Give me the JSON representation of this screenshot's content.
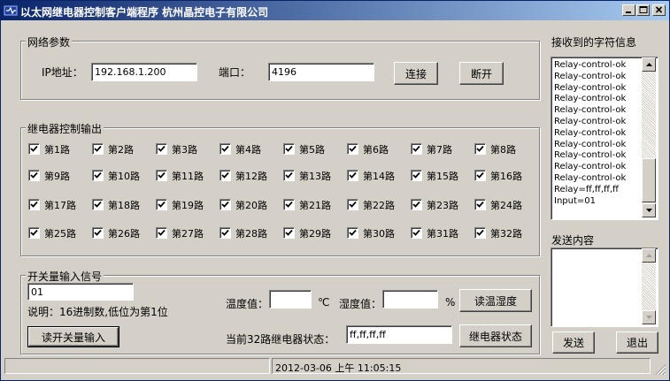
{
  "window": {
    "title": "以太网继电器控制客户端程序  杭州晶控电子有限公司"
  },
  "network": {
    "legend": "网络参数",
    "ip_label": "IP地址：",
    "ip_value": "192.168.1.200",
    "port_label": "端口：",
    "port_value": "4196",
    "connect_label": "连接",
    "disconnect_label": "断开"
  },
  "relay": {
    "legend": "继电器控制输出",
    "channels": [
      "第1路",
      "第2路",
      "第3路",
      "第4路",
      "第5路",
      "第6路",
      "第7路",
      "第8路",
      "第9路",
      "第10路",
      "第11路",
      "第12路",
      "第13路",
      "第14路",
      "第15路",
      "第16路",
      "第17路",
      "第18路",
      "第19路",
      "第20路",
      "第21路",
      "第22路",
      "第23路",
      "第24路",
      "第25路",
      "第26路",
      "第27路",
      "第28路",
      "第29路",
      "第30路",
      "第31路",
      "第32路"
    ]
  },
  "switch_input": {
    "legend": "开关量输入信号",
    "value": "01",
    "note": "说明：16进制数,低位为第1位",
    "read_label": "读开关量输入"
  },
  "sensor": {
    "temp_label": "温度值：",
    "temp_value": "",
    "temp_unit": "℃",
    "humidity_label": "湿度值：",
    "humidity_value": "",
    "humidity_unit": "%",
    "read_label": "读温湿度"
  },
  "relay_status": {
    "label": "当前32路继电器状态：",
    "value": "ff,ff,ff,ff",
    "button_label": "继电器状态"
  },
  "received": {
    "title": "接收到的字符信息",
    "lines": [
      "Relay-control-ok",
      "Relay-control-ok",
      "Relay-control-ok",
      "Relay-control-ok",
      "Relay-control-ok",
      "Relay-control-ok",
      "Relay-control-ok",
      "Relay-control-ok",
      "Relay-control-ok",
      "Relay-control-ok",
      "Relay-control-ok",
      "Relay=ff,ff,ff,ff",
      "Input=01"
    ]
  },
  "send": {
    "title": "发送内容",
    "send_label": "发送",
    "exit_label": "退出"
  },
  "statusbar": {
    "datetime": "2012-03-06 上午 11:05:15"
  },
  "colors": {
    "title_start": "#0a246a",
    "title_end": "#a6caf0",
    "face": "#d4d0c8"
  },
  "icons": [
    "app-icon",
    "minimize-icon",
    "maximize-icon",
    "close-icon",
    "checkmark-icon",
    "arrow-up-icon",
    "arrow-down-icon",
    "size-grip-icon"
  ]
}
